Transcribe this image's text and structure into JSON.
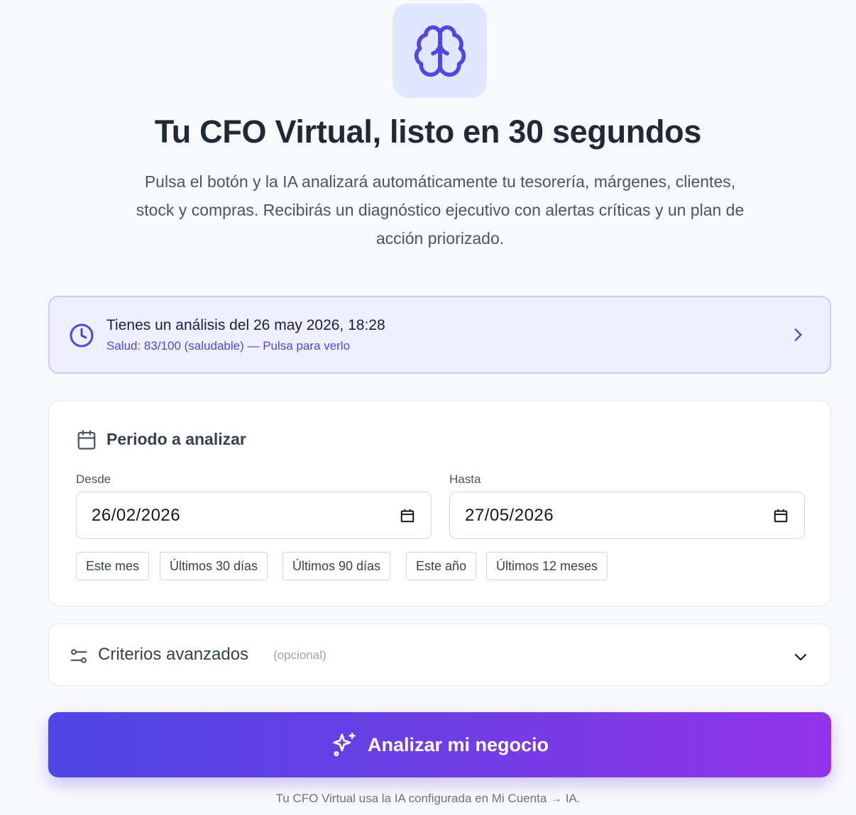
{
  "hero": {
    "icon": "brain-icon",
    "title": "Tu CFO Virtual, listo en 30 segundos",
    "subtitle": "Pulsa el botón y la IA analizará automáticamente tu tesorería, márgenes, clientes, stock y compras. Recibirás un diagnóstico ejecutivo con alertas críticas y un plan de acción priorizado."
  },
  "last_analysis": {
    "icon": "clock-icon",
    "title": "Tienes un análisis del 26 may 2026, 18:28",
    "subtitle": "Salud: 83/100 (saludable) — Pulsa para verlo"
  },
  "period": {
    "icon": "calendar-icon",
    "heading": "Periodo a analizar",
    "from_label": "Desde",
    "from_value": "26/02/2026",
    "to_label": "Hasta",
    "to_value": "27/05/2026",
    "presets": [
      "Este mes",
      "Últimos 30 días",
      "Últimos 90 días",
      "Este año",
      "Últimos 12 meses"
    ]
  },
  "advanced": {
    "icon": "sliders-icon",
    "title": "Criterios avanzados",
    "optional": "(opcional)"
  },
  "cta": {
    "icon": "sparkles-icon",
    "label": "Analizar mi negocio"
  },
  "footnote": "Tu CFO Virtual usa la IA configurada en Mi Cuenta → IA.",
  "colors": {
    "accent": "#4f46e5",
    "gradient_start": "#4f46e5",
    "gradient_end": "#9333ea",
    "banner_bg": "#eef0ff"
  }
}
